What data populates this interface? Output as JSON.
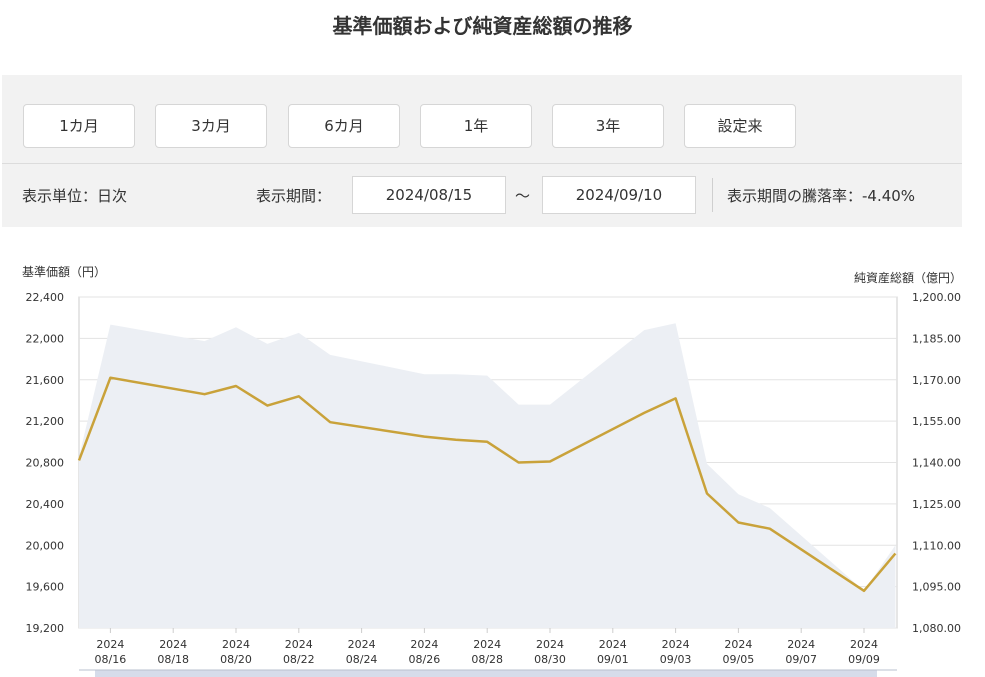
{
  "title": "基準価額および純資産総額の推移",
  "period_buttons": [
    "1カ月",
    "3カ月",
    "6カ月",
    "1年",
    "3年",
    "設定来"
  ],
  "display_unit": "表示単位：日次",
  "display_period_label": "表示期間：",
  "date_from": "2024/08/15",
  "date_sep": "～",
  "date_to": "2024/09/10",
  "change_rate": "表示期間の騰落率：-4.40%",
  "colors": {
    "nav_line": "#c9a23a",
    "assets_area": "#eceff4",
    "panel_bg": "#f2f2f2"
  },
  "chart_data": {
    "type": "line",
    "title": "",
    "ylabel": "基準価額（円）",
    "y2label": "純資産総額（億円）",
    "ylim": [
      19200,
      22400
    ],
    "y2lim": [
      1080,
      1200
    ],
    "yticks": [
      "22,400",
      "22,000",
      "21,600",
      "21,200",
      "20,800",
      "20,400",
      "20,000",
      "19,600",
      "19,200"
    ],
    "y2ticks": [
      "1,200.00",
      "1,185.00",
      "1,170.00",
      "1,155.00",
      "1,140.00",
      "1,125.00",
      "1,110.00",
      "1,095.00",
      "1,080.00"
    ],
    "xtick_labels": [
      [
        "2024",
        "08/16"
      ],
      [
        "2024",
        "08/18"
      ],
      [
        "2024",
        "08/20"
      ],
      [
        "2024",
        "08/22"
      ],
      [
        "2024",
        "08/24"
      ],
      [
        "2024",
        "08/26"
      ],
      [
        "2024",
        "08/28"
      ],
      [
        "2024",
        "08/30"
      ],
      [
        "2024",
        "09/01"
      ],
      [
        "2024",
        "09/03"
      ],
      [
        "2024",
        "09/05"
      ],
      [
        "2024",
        "09/07"
      ],
      [
        "2024",
        "09/09"
      ]
    ],
    "grid": true,
    "series": [
      {
        "type": "line",
        "dates": [
          "2024-08-15",
          "2024-08-16",
          "2024-08-19",
          "2024-08-20",
          "2024-08-21",
          "2024-08-22",
          "2024-08-23",
          "2024-08-26",
          "2024-08-27",
          "2024-08-28",
          "2024-08-29",
          "2024-08-30",
          "2024-09-02",
          "2024-09-03",
          "2024-09-04",
          "2024-09-05",
          "2024-09-06",
          "2024-09-09",
          "2024-09-10"
        ],
        "values": [
          20820,
          21620,
          21460,
          21540,
          21350,
          21440,
          21190,
          21050,
          21020,
          21000,
          20800,
          20810,
          21280,
          21420,
          20500,
          20220,
          20160,
          19560,
          19920
        ]
      },
      {
        "type": "area",
        "dates": [
          "2024-08-15",
          "2024-08-16",
          "2024-08-19",
          "2024-08-20",
          "2024-08-21",
          "2024-08-22",
          "2024-08-23",
          "2024-08-26",
          "2024-08-27",
          "2024-08-28",
          "2024-08-29",
          "2024-08-30",
          "2024-09-02",
          "2024-09-03",
          "2024-09-04",
          "2024-09-05",
          "2024-09-06",
          "2024-09-09",
          "2024-09-10"
        ],
        "values": [
          1142,
          1190,
          1184,
          1189,
          1183,
          1187,
          1179,
          1172,
          1172,
          1171.5,
          1161,
          1161,
          1188,
          1190.5,
          1139.5,
          1128.5,
          1123.5,
          1093.5,
          1110
        ]
      }
    ]
  }
}
